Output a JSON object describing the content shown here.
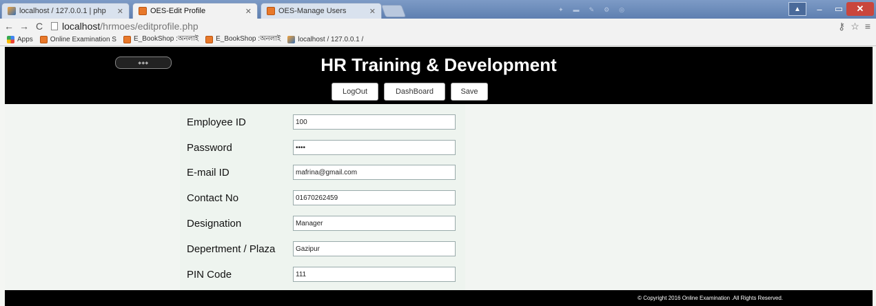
{
  "browser": {
    "tabs": [
      {
        "label": "localhost / 127.0.0.1 | php",
        "icon": "phpmyadmin-icon"
      },
      {
        "label": "OES-Edit Profile",
        "icon": "oes-icon",
        "active": true
      },
      {
        "label": "OES-Manage Users",
        "icon": "oes-icon"
      }
    ],
    "url_host": "localhost",
    "url_path": "/hrmoes/editprofile.php",
    "bookmarks": [
      {
        "label": "Apps",
        "icon": "apps-icon"
      },
      {
        "label": "Online Examination S",
        "icon": "oes-icon"
      },
      {
        "label": "E_BookShop :অনলাই",
        "icon": "oes-icon"
      },
      {
        "label": "E_BookShop :অনলাই",
        "icon": "oes-icon"
      },
      {
        "label": "localhost / 127.0.0.1 /",
        "icon": "phpmyadmin-icon"
      }
    ]
  },
  "header": {
    "title": "HR Training & Development",
    "buttons": {
      "logout": "LogOut",
      "dashboard": "DashBoard",
      "save": "Save"
    }
  },
  "form": {
    "fields": [
      {
        "label": "Employee ID",
        "value": "100"
      },
      {
        "label": "Password",
        "value": "••••"
      },
      {
        "label": "E-mail ID",
        "value": "mafrina@gmail.com"
      },
      {
        "label": "Contact No",
        "value": "01670262459"
      },
      {
        "label": "Designation",
        "value": "Manager"
      },
      {
        "label": "Depertment / Plaza",
        "value": "Gazipur"
      },
      {
        "label": "PIN Code",
        "value": "111"
      }
    ]
  },
  "footer": {
    "text": "© Copyright 2016 Online Examination .All Rights Reserved."
  },
  "colors": {
    "header_bg": "#000000",
    "page_bg": "#f2f5f2",
    "tabstrip": "#6f8fbd"
  }
}
